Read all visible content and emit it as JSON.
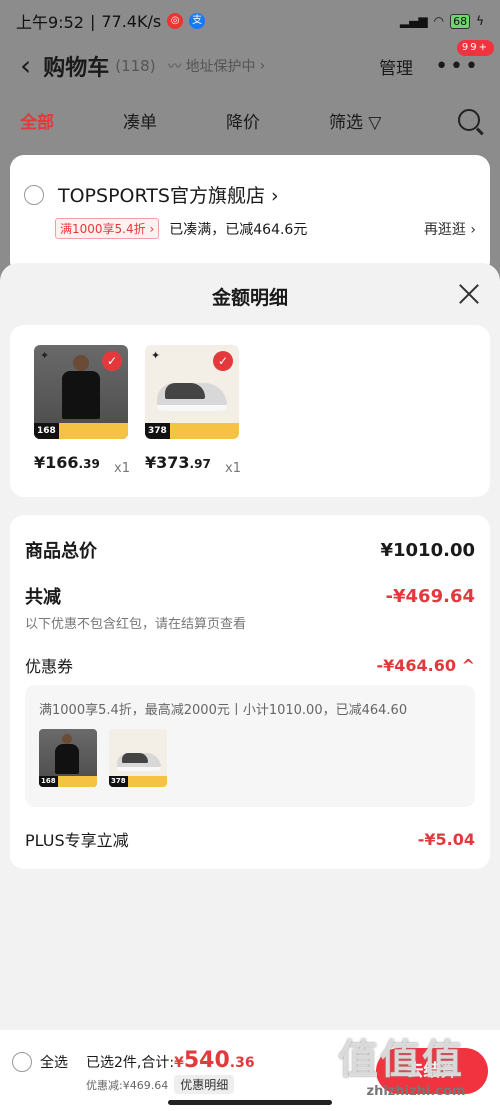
{
  "statusbar": {
    "time": "上午9:52",
    "speed": "77.4K/s",
    "battery": "68"
  },
  "header": {
    "back_icon": "chevron-left-icon",
    "title": "购物车",
    "count": "(118)",
    "protect": "地址保护中",
    "manage": "管理",
    "more_badge": "99+"
  },
  "tabs": [
    {
      "label": "全部",
      "active": true
    },
    {
      "label": "凑单"
    },
    {
      "label": "降价"
    },
    {
      "label": "筛选"
    }
  ],
  "store": {
    "name": "TOPSPORTS官方旗舰店",
    "coupon_tag": "满1000享5.4折",
    "coupon_status": "已凑满，已减464.6元",
    "more": "再逛逛"
  },
  "sheet": {
    "title": "金额明细",
    "products": [
      {
        "kind": "shirt",
        "badge_price": "168",
        "price_int": "¥166",
        "price_dec": ".39",
        "qty": "x1"
      },
      {
        "kind": "shoe",
        "badge_price": "378",
        "price_int": "¥373",
        "price_dec": ".97",
        "qty": "x1"
      }
    ],
    "total_label": "商品总价",
    "total_value": "¥1010.00",
    "reduce_label": "共减",
    "reduce_value": "-¥469.64",
    "note": "以下优惠不包含红包，请在结算页查看",
    "coupon_label": "优惠券",
    "coupon_value": "-¥464.60",
    "coupon_desc": "满1000享5.4折，最高减2000元丨小计1010.00，已减464.60",
    "plus_label": "PLUS专享立减",
    "plus_value": "-¥5.04"
  },
  "bottom": {
    "select_all": "全选",
    "selected": "已选2件,",
    "sum_label": "合计:",
    "currency": "¥",
    "total_int": "540",
    "total_dec": ".36",
    "discount": "优惠减:¥469.64",
    "detail_btn": "优惠明细",
    "checkout": "去结算"
  },
  "watermark": {
    "big": "值值值",
    "small": "zhizhizhi.com"
  },
  "colors": {
    "accent": "#e4393c",
    "checkout": "#f0333f"
  }
}
